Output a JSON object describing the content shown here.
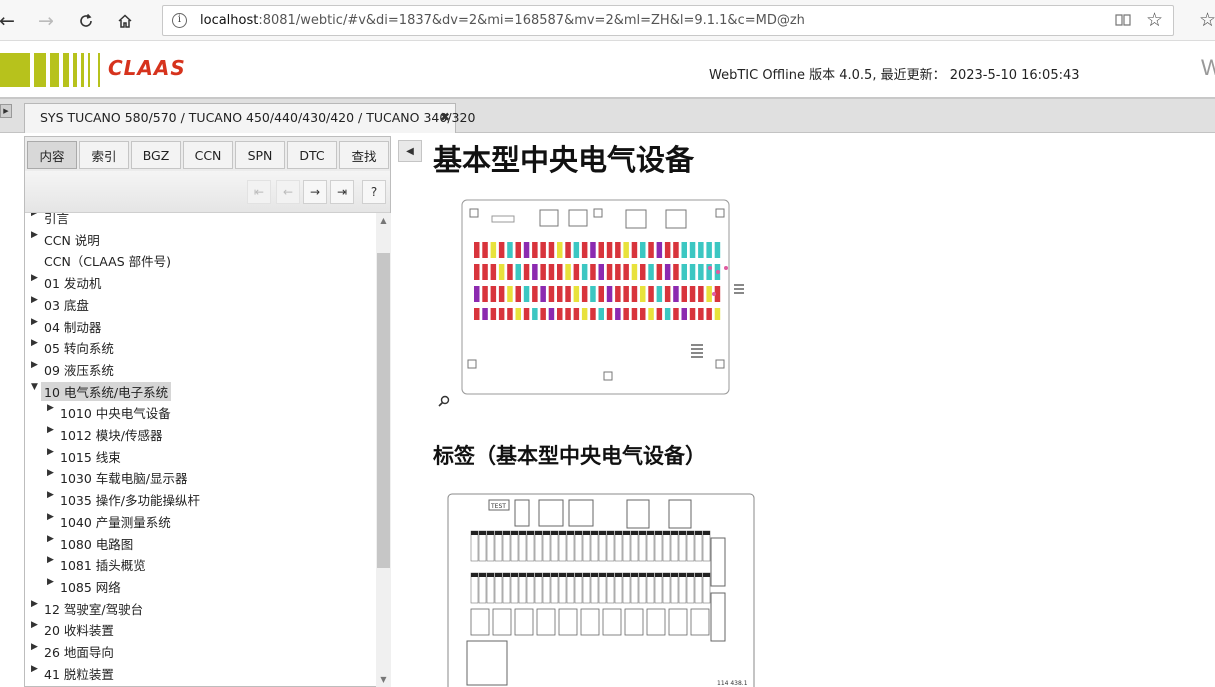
{
  "browser": {
    "url_host": "localhost",
    "url_rest": ":8081/webtic/#v&di=1837&dv=2&mi=168587&mv=2&ml=ZH&l=9.1.1&c=MD@zh"
  },
  "header": {
    "logo_text": "CLAAS",
    "version": "WebTIC Offline 版本 4.0.5, 最近更新： 2023-5-10 16:05:43",
    "cut_letter": "W"
  },
  "tab": {
    "label": "SYS TUCANO 580/570 / TUCANO 450/440/430/420 / TUCANO 340/320",
    "close": "✖"
  },
  "side_tabs": [
    "内容",
    "索引",
    "BGZ",
    "CCN",
    "SPN",
    "DTC",
    "查找"
  ],
  "toolbar": {
    "help": "?"
  },
  "tree": [
    {
      "label": "引言",
      "arrow": true,
      "level": 0
    },
    {
      "label": "CCN 说明",
      "arrow": true,
      "level": 0
    },
    {
      "label": "CCN（CLAAS 部件号)",
      "arrow": false,
      "level": 0
    },
    {
      "label": "01 发动机",
      "arrow": true,
      "level": 0
    },
    {
      "label": "03 底盘",
      "arrow": true,
      "level": 0
    },
    {
      "label": "04 制动器",
      "arrow": true,
      "level": 0
    },
    {
      "label": "05 转向系统",
      "arrow": true,
      "level": 0
    },
    {
      "label": "09 液压系统",
      "arrow": true,
      "level": 0
    },
    {
      "label": "10 电气系统/电子系统",
      "arrow": true,
      "level": 0,
      "expanded": true,
      "selected": true
    },
    {
      "label": "1010 中央电气设备",
      "arrow": true,
      "level": 1
    },
    {
      "label": "1012 模块/传感器",
      "arrow": true,
      "level": 1
    },
    {
      "label": "1015 线束",
      "arrow": true,
      "level": 1
    },
    {
      "label": "1030 车载电脑/显示器",
      "arrow": true,
      "level": 1
    },
    {
      "label": "1035 操作/多功能操纵杆",
      "arrow": true,
      "level": 1
    },
    {
      "label": "1040 产量测量系统",
      "arrow": true,
      "level": 1
    },
    {
      "label": "1080 电路图",
      "arrow": true,
      "level": 1
    },
    {
      "label": "1081 插头概览",
      "arrow": true,
      "level": 1
    },
    {
      "label": "1085 网络",
      "arrow": true,
      "level": 1
    },
    {
      "label": "12 驾驶室/驾驶台",
      "arrow": true,
      "level": 0
    },
    {
      "label": "20 收料装置",
      "arrow": true,
      "level": 0
    },
    {
      "label": "26 地面导向",
      "arrow": true,
      "level": 0
    },
    {
      "label": "41 脱粒装置",
      "arrow": true,
      "level": 0
    }
  ],
  "main": {
    "title": "基本型中央电气设备",
    "section_title": "标签（基本型中央电气设备）",
    "diagram2_code": "114 438.1",
    "diagram2_test": "TEST"
  },
  "colors": {
    "logo_green": "#b7c21c",
    "logo_red": "#d6331d",
    "fuse_red": "#d8343c",
    "fuse_purple": "#8c2ab0",
    "fuse_cyan": "#3cc7c2",
    "fuse_yellow": "#e8e23c"
  }
}
